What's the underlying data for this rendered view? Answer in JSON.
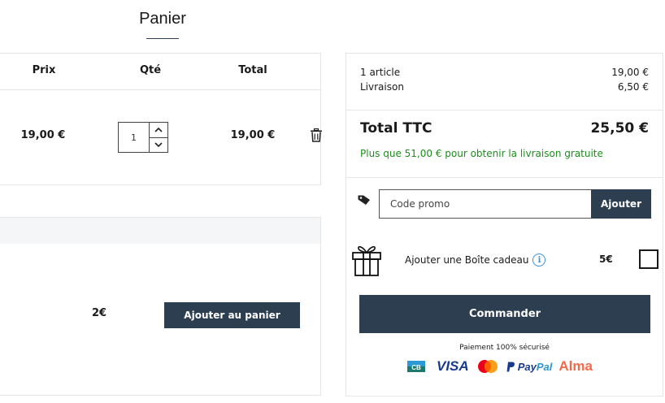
{
  "page": {
    "title": "Panier"
  },
  "cart_table": {
    "headers": {
      "price": "Prix",
      "qty": "Qté",
      "total": "Total"
    },
    "row": {
      "price": "19,00 €",
      "qty": "1",
      "total": "19,00 €"
    }
  },
  "upsell": {
    "price": "2€",
    "button": "Ajouter au panier"
  },
  "summary": {
    "articles_label": "1 article",
    "articles_value": "19,00 €",
    "shipping_label": "Livraison",
    "shipping_value": "6,50 €",
    "total_label": "Total TTC",
    "total_value": "25,50 €",
    "free_shipping_msg": "Plus que 51,00 € pour obtenir la livraison gratuite"
  },
  "promo": {
    "placeholder": "Code promo",
    "button": "Ajouter"
  },
  "gift": {
    "label": "Ajouter une Boîte cadeau",
    "price": "5€",
    "info": "i",
    "checked": false
  },
  "checkout": {
    "button": "Commander",
    "secure_text": "Paiement 100% sécurisé",
    "payment_logos": {
      "cb": "CB",
      "visa": "VISA",
      "paypal_a": "Pay",
      "paypal_b": "Pal",
      "alma": "Alma"
    }
  },
  "colors": {
    "accent": "#2c3e50",
    "success": "#1e8c1e",
    "info": "#3a8fd1",
    "alma": "#f26a4b",
    "visa": "#1a3b8c"
  },
  "icons": [
    "chevron-up-icon",
    "chevron-down-icon",
    "trash-icon",
    "tag-icon",
    "gift-icon",
    "info-icon",
    "cb-card-icon",
    "mastercard-icon",
    "paypal-icon"
  ]
}
